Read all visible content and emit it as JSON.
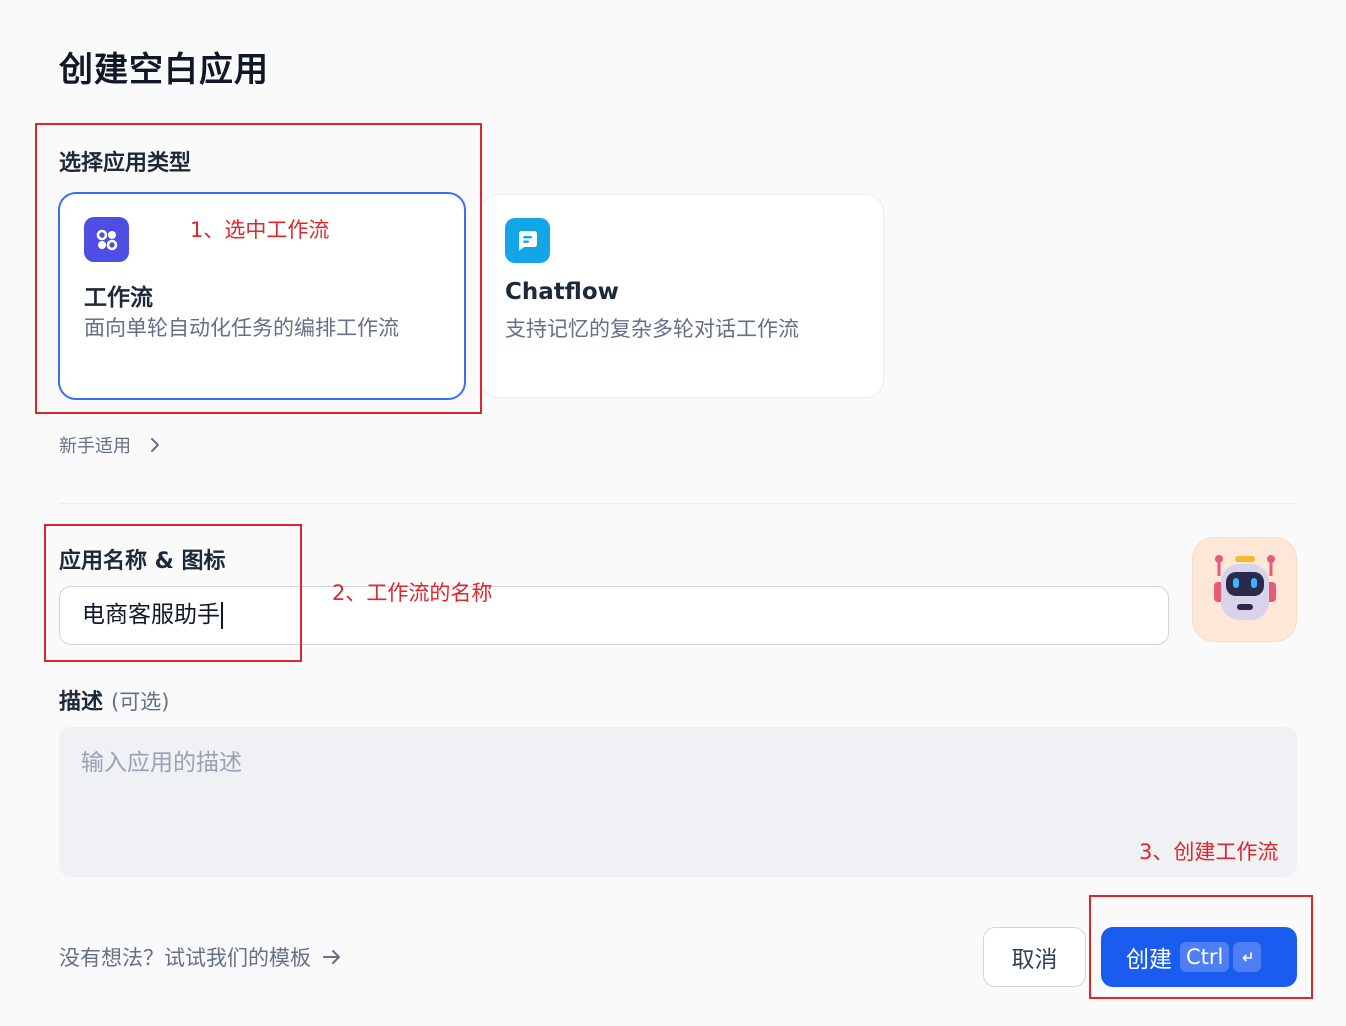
{
  "page": {
    "title": "创建空白应用"
  },
  "app_type": {
    "label": "选择应用类型",
    "cards": [
      {
        "title": "工作流",
        "description": "面向单轮自动化任务的编排工作流",
        "icon": "workflow-icon",
        "color": "#4e4ee4",
        "selected": true
      },
      {
        "title": "Chatflow",
        "description": "支持记忆的复杂多轮对话工作流",
        "icon": "chat-bubble-icon",
        "color": "#12a5e8",
        "selected": false
      }
    ],
    "beginner_link": "新手适用"
  },
  "name_icon": {
    "label": "应用名称 & 图标",
    "value": "电商客服助手",
    "icon": "robot-avatar-icon"
  },
  "description": {
    "label": "描述",
    "optional": "(可选)",
    "placeholder": "输入应用的描述"
  },
  "footer": {
    "template_link": "没有想法？试试我们的模板",
    "cancel": "取消",
    "create": "创建",
    "shortcut": "Ctrl"
  },
  "annotations": {
    "step1": "1、选中工作流",
    "step2": "2、工作流的名称",
    "step3": "3、创建工作流",
    "color": "#e0262b"
  },
  "colors": {
    "primary": "#1b5cf0",
    "selected_border": "#3b6ef6"
  }
}
